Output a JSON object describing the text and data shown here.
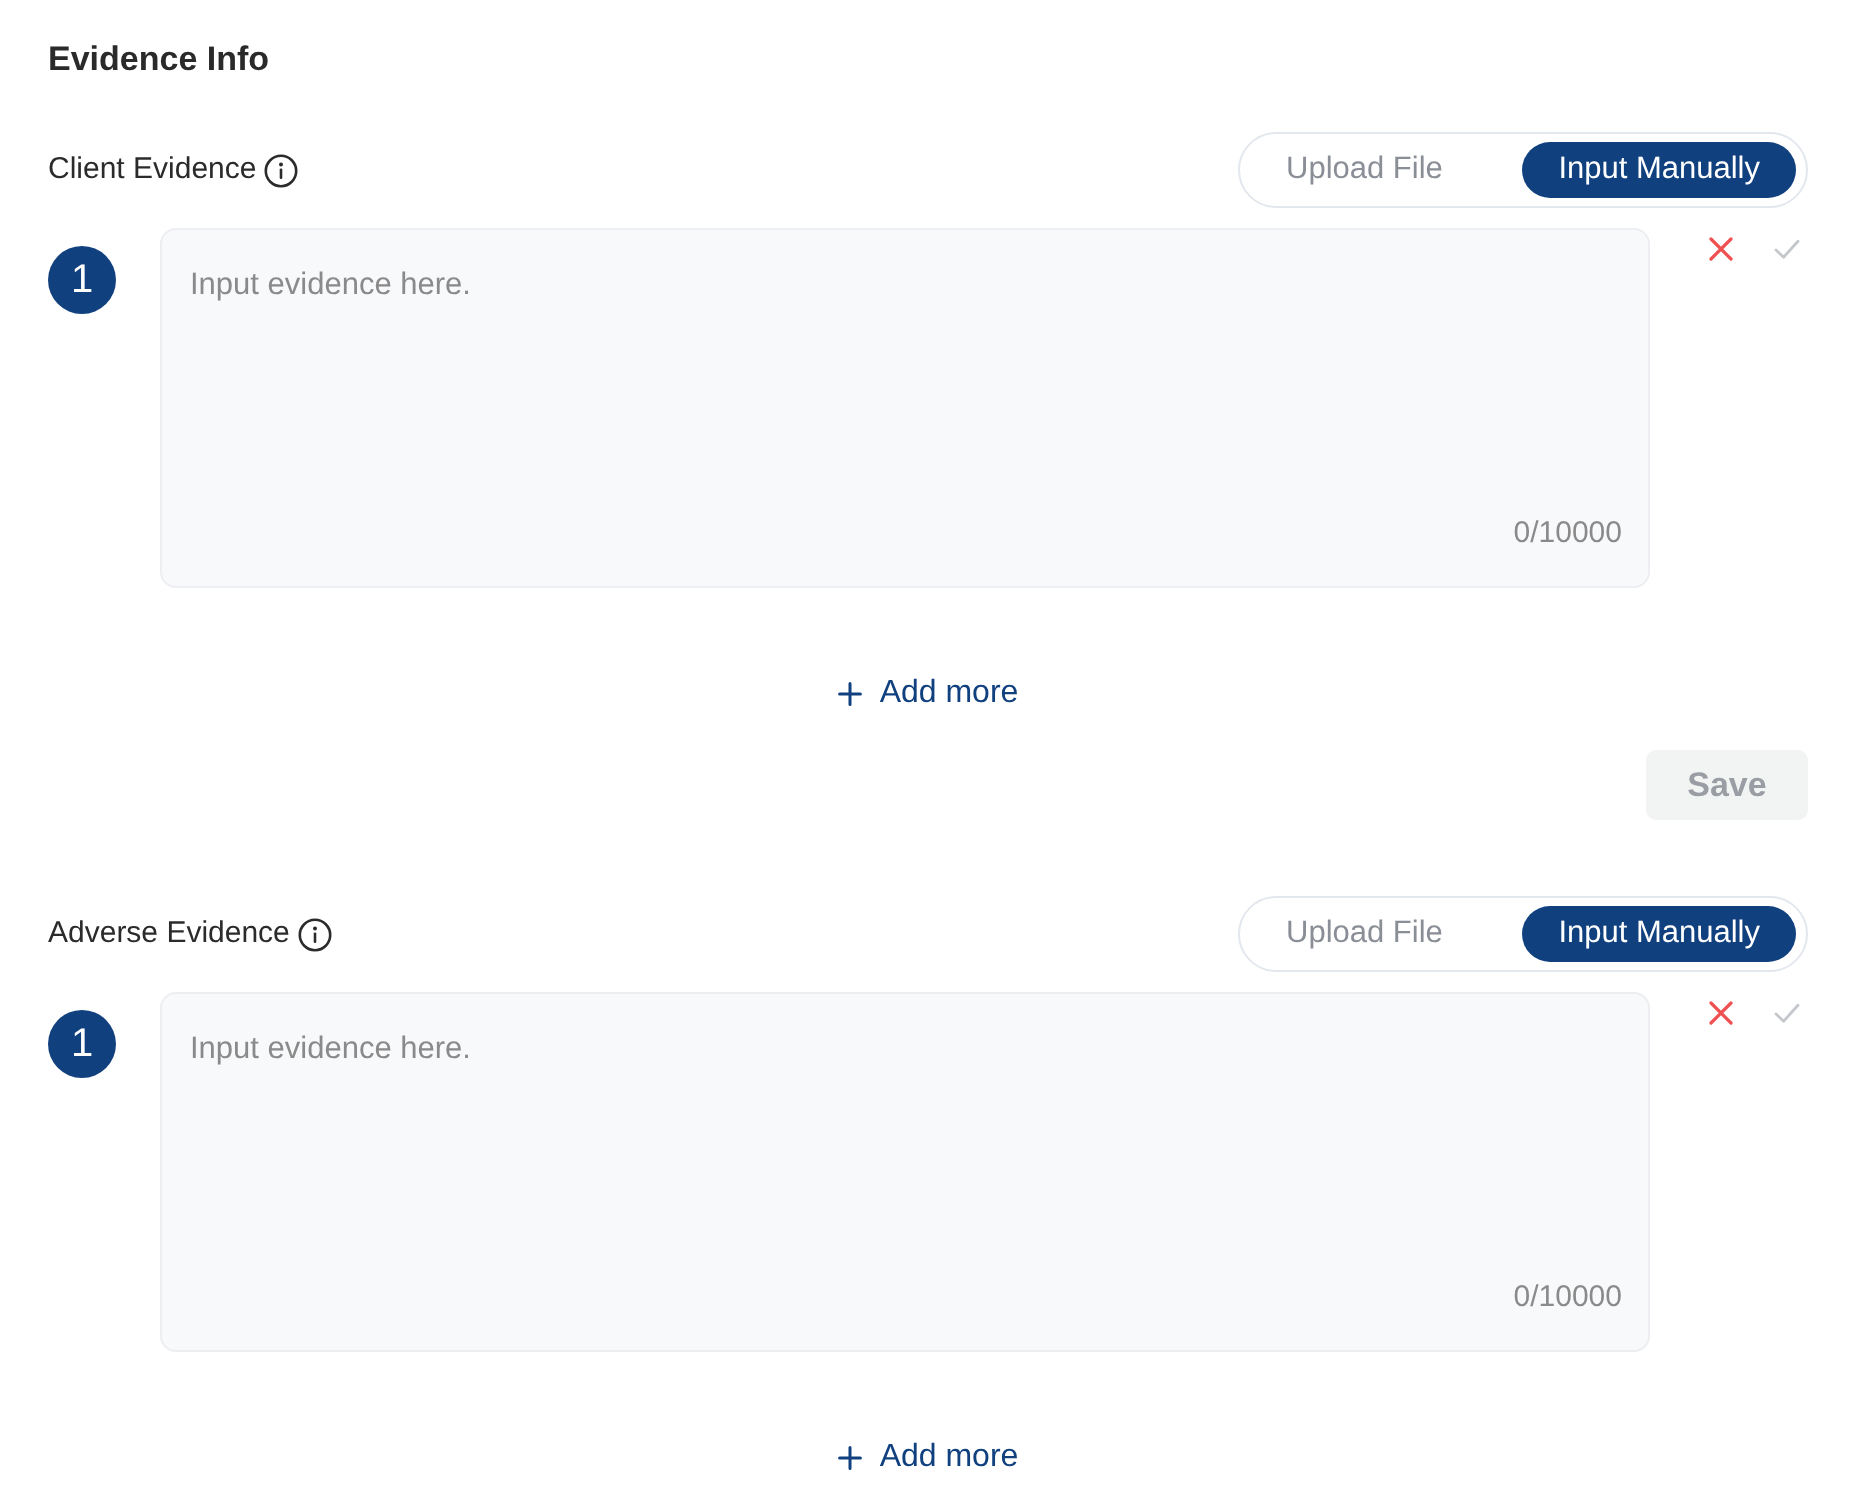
{
  "heading": "Evidence Info",
  "sections": [
    {
      "title": "Client Evidence",
      "mode_options": [
        {
          "label": "Upload File",
          "selected": false
        },
        {
          "label": "Input Manually",
          "selected": true
        }
      ],
      "entries": [
        {
          "number": "1",
          "placeholder": "Input evidence here.",
          "counter": "0/10000"
        }
      ],
      "add_more": "Add more",
      "save": {
        "label": "Save",
        "disabled": true
      }
    },
    {
      "title": "Adverse Evidence",
      "mode_options": [
        {
          "label": "Upload File",
          "selected": false
        },
        {
          "label": "Input Manually",
          "selected": true
        }
      ],
      "entries": [
        {
          "number": "1",
          "placeholder": "Input evidence here.",
          "counter": "0/10000"
        }
      ],
      "add_more": "Add more"
    }
  ]
}
